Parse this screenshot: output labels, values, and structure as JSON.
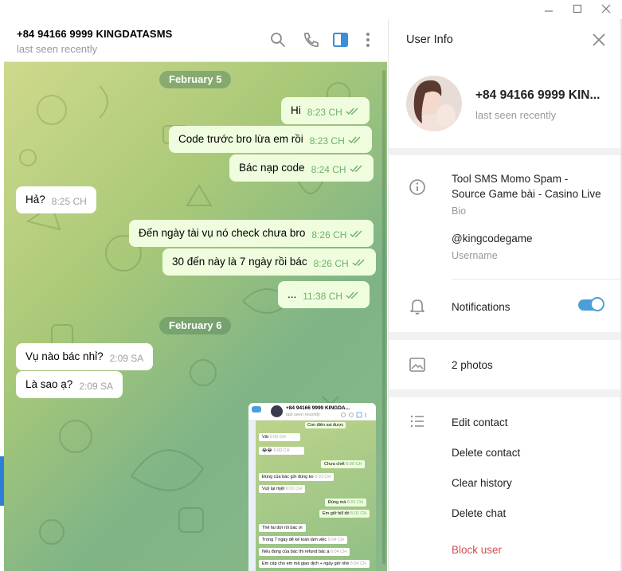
{
  "window": {
    "minimize_icon": "minimize-icon",
    "maximize_icon": "maximize-icon",
    "close_icon": "close-icon"
  },
  "chat_header": {
    "title": "+84 94166 9999 KINGDATASMS",
    "status": "last seen recently",
    "icons": [
      "search-icon",
      "phone-icon",
      "sidebar-toggle-icon",
      "more-vertical-icon"
    ]
  },
  "messages": {
    "date1": "February 5",
    "date2": "February 6",
    "items": [
      {
        "dir": "out",
        "text": "Hi",
        "time": "8:23 CH"
      },
      {
        "dir": "out",
        "text": "Code trước bro lừa em rồi",
        "time": "8:23 CH"
      },
      {
        "dir": "out",
        "text": "Bác nạp code",
        "time": "8:24 CH"
      },
      {
        "dir": "in",
        "text": "Hả?",
        "time": "8:25 CH"
      },
      {
        "dir": "out",
        "text": "Đến ngày tài vụ nó check chưa bro",
        "time": "8:26 CH"
      },
      {
        "dir": "out",
        "text": "30 đến này là 7 ngày rồi bác",
        "time": "8:26 CH"
      },
      {
        "dir": "out",
        "text": "...",
        "time": "11:38 CH"
      },
      {
        "dir": "in",
        "text": "Vụ nào bác nhỉ?",
        "time": "2:09 SA"
      },
      {
        "dir": "in",
        "text": "Là sao ạ?",
        "time": "2:09 SA"
      }
    ]
  },
  "photo_preview": {
    "title": "+84 94166 9999 KINGDA...",
    "status": "last seen recently",
    "lines": [
      {
        "dir": "out",
        "text": "Con điên sai được"
      },
      {
        "dir": "in",
        "text": "Vãi",
        "time": "6:00 CH"
      },
      {
        "dir": "in",
        "text": "😂😂",
        "time": "6:00 CH"
      },
      {
        "dir": "out",
        "text": "Chưa chết",
        "time": "6:00 CH"
      },
      {
        "dir": "in",
        "text": "Đúng của bác gửi đúng ko",
        "time": "6:01 CH"
      },
      {
        "dir": "in",
        "text": "Vuỹ lại mjệt",
        "time": "6:01 CH"
      },
      {
        "dir": "out",
        "text": "Đúng mà",
        "time": "6:01 CH"
      },
      {
        "dir": "out",
        "text": "Em giỡ bill đó",
        "time": "6:01 CH"
      },
      {
        "dir": "in",
        "text": "Thế fai đợi rồi bác ơi"
      },
      {
        "dir": "in",
        "text": "Trong 7 ngày để kế toán làm việc",
        "time": "6:04 CH"
      },
      {
        "dir": "in",
        "text": "Nếu đúng của bác thì refund bác ạ",
        "time": "6:04 CH"
      },
      {
        "dir": "in",
        "text": "Em cấp cho em mã giao dịch + ngày giờ nhé",
        "time": "6:04 CH"
      }
    ]
  },
  "user_info": {
    "header": "User Info",
    "name": "+84 94166 9999 KIN...",
    "status": "last seen recently",
    "bio_line1": "Tool SMS Momo Spam -",
    "bio_line2": "Source Game bài - Casino Live",
    "bio_label": "Bio",
    "username": "@kingcodegame",
    "username_label": "Username",
    "notifications_label": "Notifications",
    "notifications_on": true,
    "photos_label": "2 photos",
    "actions": {
      "edit": "Edit contact",
      "delete_contact": "Delete contact",
      "clear": "Clear history",
      "delete_chat": "Delete chat",
      "block": "Block user"
    }
  },
  "colors": {
    "accent": "#4a9fd8",
    "outgoing_bubble": "#effdde",
    "check_green": "#6bb26b",
    "danger": "#d14e4e"
  }
}
